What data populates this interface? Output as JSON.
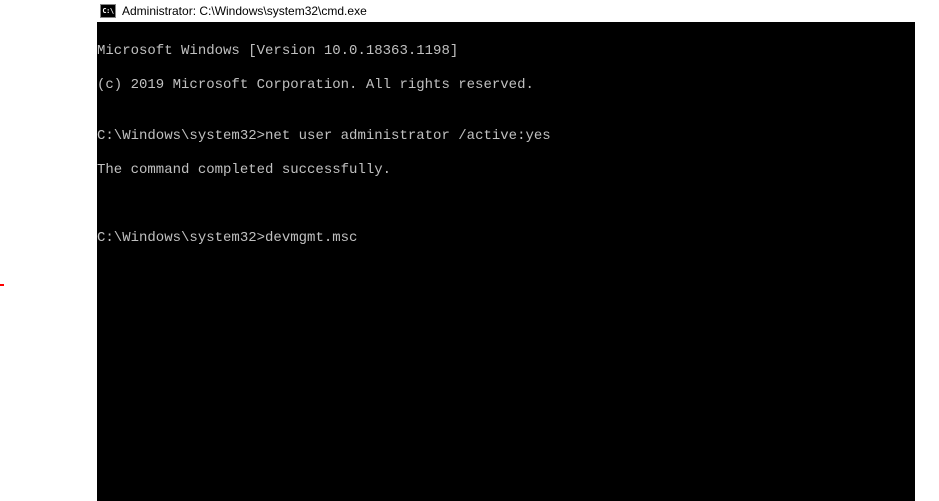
{
  "window": {
    "icon_label": "C:\\",
    "title": "Administrator: C:\\Windows\\system32\\cmd.exe"
  },
  "terminal": {
    "banner1": "Microsoft Windows [Version 10.0.18363.1198]",
    "banner2": "(c) 2019 Microsoft Corporation. All rights reserved.",
    "blank": "",
    "prompt1": "C:\\Windows\\system32>",
    "command1": "net user administrator /active:yes",
    "result1": "The command completed successfully.",
    "prompt2": "C:\\Windows\\system32>",
    "command2": "devmgmt.msc"
  }
}
